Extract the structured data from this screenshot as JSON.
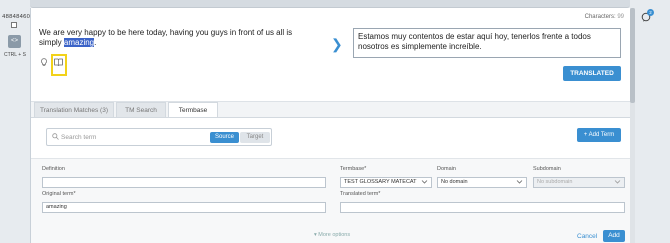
{
  "segment": {
    "id": "4884846054",
    "shortcut": "CTRL + S",
    "characters_label": "Characters:",
    "characters_count": "99",
    "source_pre": "We are very happy to be here today, having you guys in front of us all is simply ",
    "source_highlight": "amazing",
    "source_post": ".",
    "target_text": "Estamos muy contentos de estar aquí hoy, tenerlos frente a todos nosotros es simplemente increíble.",
    "status_button": "TRANSLATED"
  },
  "panel": {
    "tabs": [
      {
        "label": "Translation Matches (3)"
      },
      {
        "label": "TM Search"
      },
      {
        "label": "Termbase"
      }
    ],
    "search": {
      "placeholder": "Search term",
      "source_label": "Source",
      "target_label": "Target"
    },
    "add_term_label": "+ Add Term",
    "form": {
      "definition_label": "Definition",
      "definition_value": "",
      "termbase_label": "Termbase*",
      "termbase_value": "TEST GLOSSARY MATECAT",
      "domain_label": "Domain",
      "domain_value": "No domain",
      "subdomain_label": "Subdomain",
      "subdomain_value": "No subdomain",
      "original_label": "Original term*",
      "original_value": "amazing",
      "translated_label": "Translated term*",
      "translated_value": "",
      "more_options": "More options",
      "cancel": "Cancel",
      "add": "Add"
    }
  },
  "notification_count": "2",
  "colors": {
    "accent": "#3a8fd1",
    "highlight": "#3b63c8",
    "focus_box": "#f2d21a"
  }
}
